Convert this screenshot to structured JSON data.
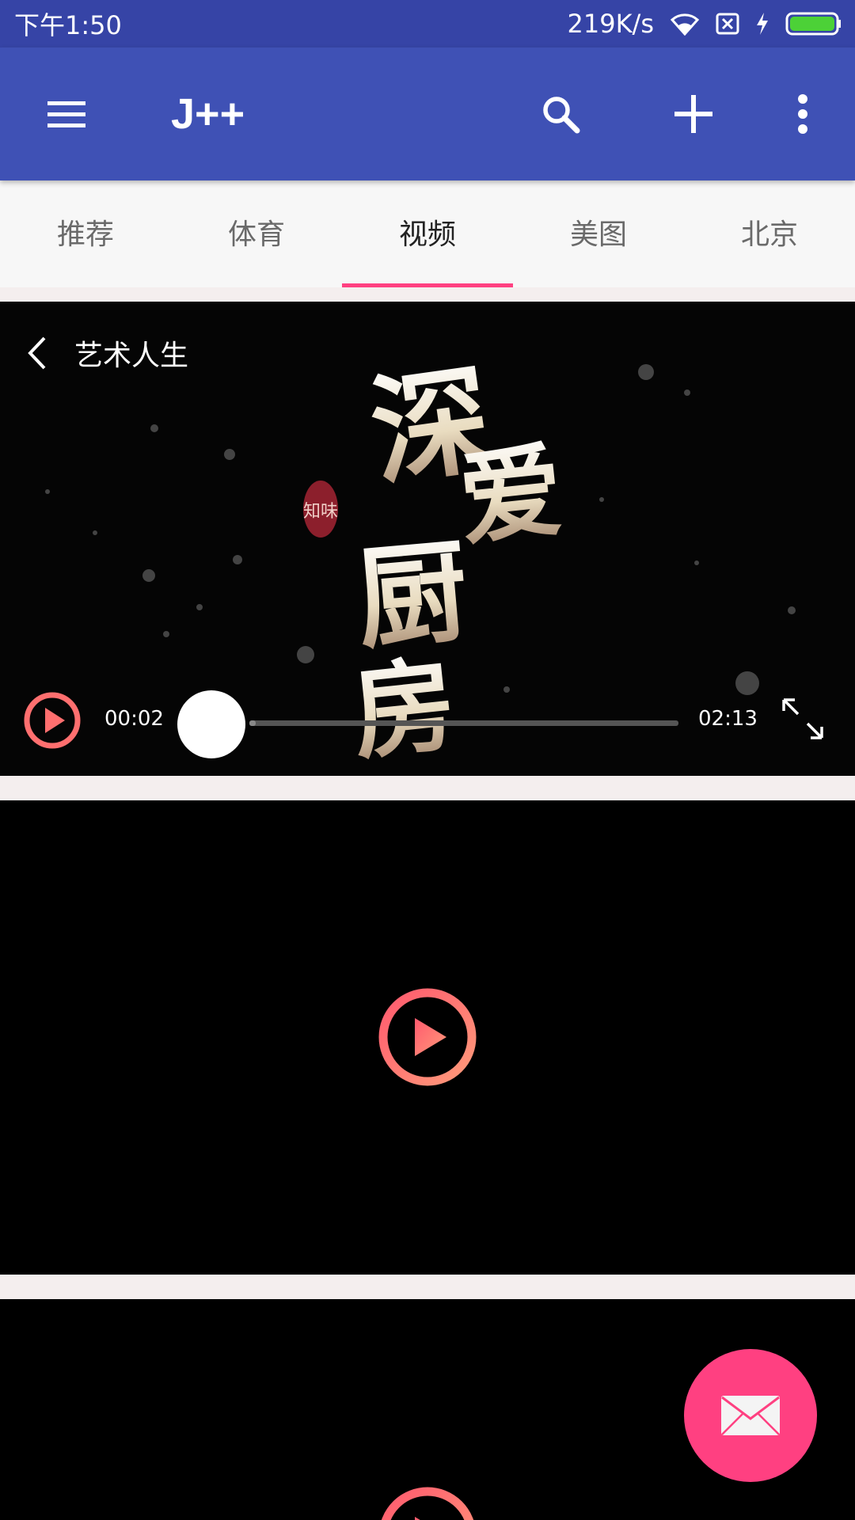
{
  "status_bar": {
    "time": "下午1:50",
    "network_speed": "219K/s",
    "icons": [
      "wifi-icon",
      "no-sim-icon",
      "charging-icon",
      "battery-icon"
    ],
    "battery_level": 1.0
  },
  "toolbar": {
    "title": "J++",
    "icons": [
      "menu-icon",
      "search-icon",
      "add-icon",
      "more-vert-icon"
    ]
  },
  "tabs": {
    "items": [
      {
        "label": "推荐"
      },
      {
        "label": "体育"
      },
      {
        "label": "视频"
      },
      {
        "label": "美图"
      },
      {
        "label": "北京"
      }
    ],
    "active_index": 2
  },
  "videos": [
    {
      "title": "艺术人生",
      "cover_text": "深爱厨房",
      "elapsed": "00:02",
      "duration": "02:13",
      "progress": 0.015,
      "state": "paused"
    },
    {
      "state": "idle"
    },
    {
      "state": "idle"
    }
  ],
  "fab": {
    "icon": "mail-icon"
  },
  "colors": {
    "primary": "#3f51b5",
    "primary_dark": "#3644a6",
    "accent": "#ff4081",
    "play_button": "#ff6f6f"
  }
}
